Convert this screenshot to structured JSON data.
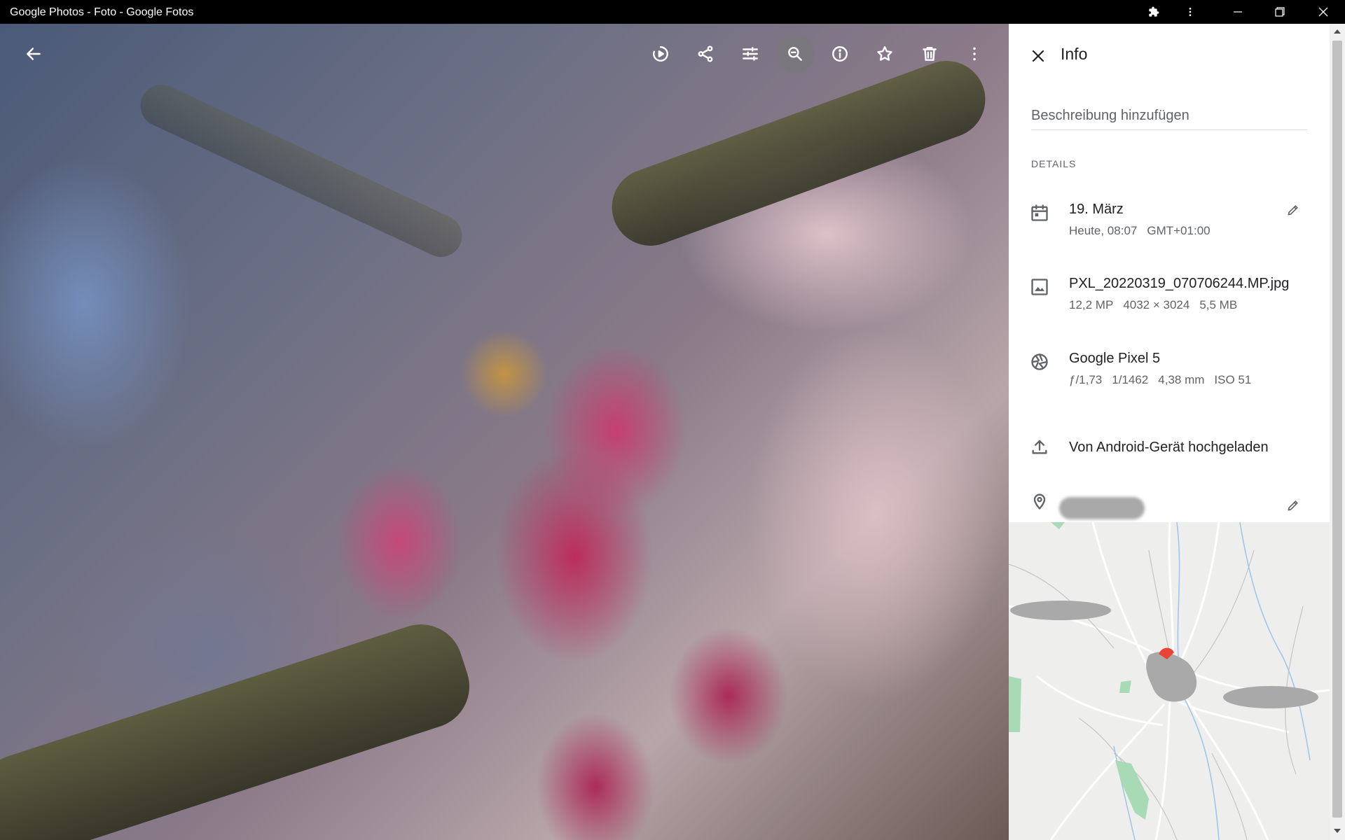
{
  "window": {
    "title": "Google Photos - Foto - Google Fotos"
  },
  "toolbar": {
    "icons": [
      "back-arrow-icon",
      "slideshow-icon",
      "share-icon",
      "edit-tune-icon",
      "zoom-icon",
      "info-icon",
      "star-icon",
      "delete-icon",
      "more-vert-icon"
    ],
    "active": "zoom-icon"
  },
  "info_panel": {
    "title": "Info",
    "description_placeholder": "Beschreibung hinzufügen",
    "section_label": "DETAILS",
    "date": {
      "primary": "19. März",
      "time": "Heute, 08:07",
      "timezone": "GMT+01:00"
    },
    "file": {
      "name": "PXL_20220319_070706244.MP.jpg",
      "megapixels": "12,2 MP",
      "resolution": "4032 × 3024",
      "size": "5,5 MB"
    },
    "camera": {
      "model": "Google Pixel 5",
      "aperture": "ƒ/1,73",
      "shutter": "1/1462",
      "focal_length": "4,38 mm",
      "iso": "ISO 51"
    },
    "upload": {
      "text": "Von Android-Gerät hochgeladen"
    },
    "location": {
      "redacted": true
    }
  },
  "colors": {
    "panel_bg": "#ffffff",
    "text_primary": "#202124",
    "text_secondary": "#5f6368",
    "map_pin": "#ea4335",
    "map_green": "#a8dab5"
  }
}
